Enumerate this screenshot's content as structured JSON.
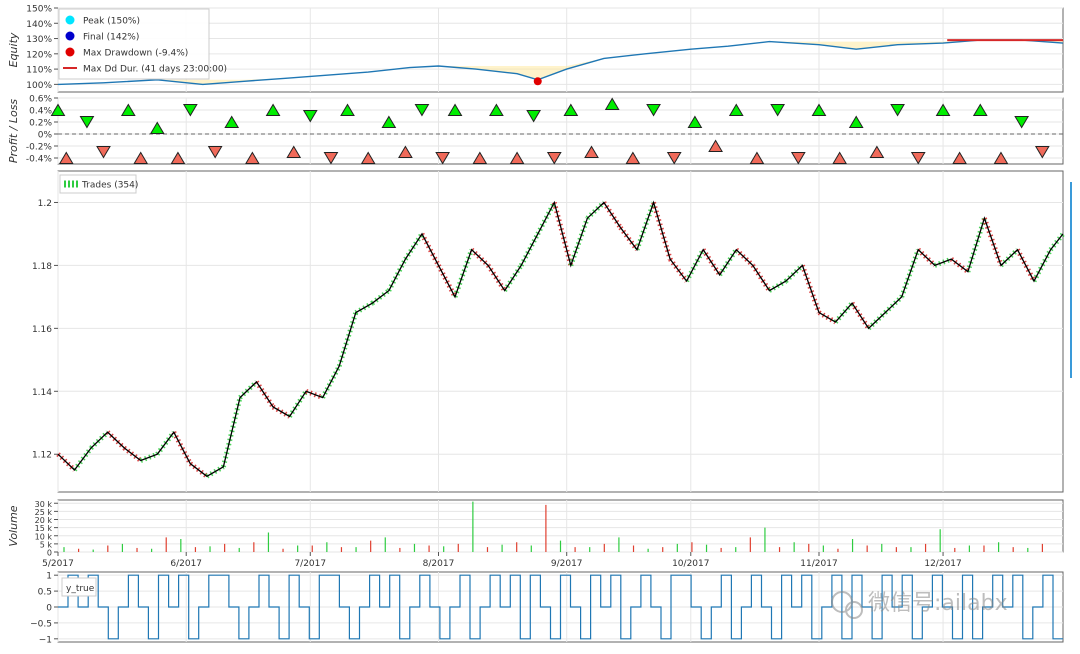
{
  "chart_data": [
    {
      "type": "line",
      "ylabel": "Equity",
      "ylim": [
        95,
        150
      ],
      "yticks": [
        "150%",
        "140%",
        "130%",
        "120%",
        "110%",
        "100%"
      ],
      "ytick_values": [
        150,
        140,
        130,
        120,
        110,
        100
      ],
      "legend": [
        "Peak (150%)",
        "Final (142%)",
        "Max Drawdown (-9.4%)",
        "Max Dd Dur. (41 days 23:00:00)"
      ],
      "legend_colors": [
        "#00e5ff",
        "#0000cc",
        "#e00000",
        "#d62728"
      ],
      "series": [
        {
          "name": "Equity",
          "color": "#1f77b4",
          "x": [
            "2017-05-01",
            "2017-05-12",
            "2017-05-25",
            "2017-06-05",
            "2017-06-15",
            "2017-06-25",
            "2017-07-05",
            "2017-07-15",
            "2017-07-25",
            "2017-08-01",
            "2017-08-10",
            "2017-08-20",
            "2017-08-25",
            "2017-09-01",
            "2017-09-10",
            "2017-09-20",
            "2017-10-01",
            "2017-10-10",
            "2017-10-20",
            "2017-11-01",
            "2017-11-10",
            "2017-11-20",
            "2017-12-01",
            "2017-12-10",
            "2017-12-20",
            "2017-12-30"
          ],
          "values": [
            100,
            101,
            103,
            100,
            102,
            104,
            106,
            108,
            111,
            112,
            110,
            107,
            103,
            110,
            117,
            120,
            123,
            125,
            128,
            126,
            123,
            126,
            127,
            129,
            129,
            127
          ]
        }
      ],
      "peak": {
        "x": "2017-12-05",
        "value": 150
      },
      "max_drawdown": {
        "x": "2017-08-25",
        "value": 102
      },
      "drawdown_duration": {
        "x_start": "2017-12-02",
        "x_end": "2017-12-30",
        "value": 129
      }
    },
    {
      "type": "scatter",
      "ylabel": "Profit / Loss",
      "ylim": [
        -0.5,
        0.6
      ],
      "yticks": [
        "0.6%",
        "0.4%",
        "0.2%",
        "0%",
        "-0.2%",
        "-0.4%"
      ],
      "ytick_values": [
        0.6,
        0.4,
        0.2,
        0,
        -0.2,
        -0.4
      ],
      "series": [
        {
          "name": "Profit",
          "color": "#00ee00",
          "x": [
            "2017-05-01",
            "2017-05-08",
            "2017-05-18",
            "2017-05-25",
            "2017-06-02",
            "2017-06-12",
            "2017-06-22",
            "2017-07-01",
            "2017-07-10",
            "2017-07-20",
            "2017-07-28",
            "2017-08-05",
            "2017-08-15",
            "2017-08-24",
            "2017-09-02",
            "2017-09-12",
            "2017-09-22",
            "2017-10-02",
            "2017-10-12",
            "2017-10-22",
            "2017-11-01",
            "2017-11-10",
            "2017-11-20",
            "2017-12-01",
            "2017-12-10",
            "2017-12-20"
          ],
          "values": [
            0.4,
            0.2,
            0.4,
            0.1,
            0.4,
            0.2,
            0.4,
            0.3,
            0.4,
            0.2,
            0.4,
            0.4,
            0.4,
            0.3,
            0.4,
            0.5,
            0.4,
            0.2,
            0.4,
            0.4,
            0.4,
            0.2,
            0.4,
            0.4,
            0.4,
            0.2
          ]
        },
        {
          "name": "Loss",
          "color": "#f06a5a",
          "x": [
            "2017-05-03",
            "2017-05-12",
            "2017-05-21",
            "2017-05-30",
            "2017-06-08",
            "2017-06-17",
            "2017-06-27",
            "2017-07-06",
            "2017-07-15",
            "2017-07-24",
            "2017-08-02",
            "2017-08-11",
            "2017-08-20",
            "2017-08-29",
            "2017-09-07",
            "2017-09-17",
            "2017-09-27",
            "2017-10-07",
            "2017-10-17",
            "2017-10-27",
            "2017-11-06",
            "2017-11-15",
            "2017-11-25",
            "2017-12-05",
            "2017-12-15",
            "2017-12-25"
          ],
          "values": [
            -0.4,
            -0.3,
            -0.4,
            -0.4,
            -0.3,
            -0.4,
            -0.3,
            -0.4,
            -0.4,
            -0.3,
            -0.4,
            -0.4,
            -0.4,
            -0.4,
            -0.3,
            -0.4,
            -0.4,
            -0.2,
            -0.4,
            -0.4,
            -0.4,
            -0.3,
            -0.4,
            -0.4,
            -0.4,
            -0.3
          ]
        }
      ]
    },
    {
      "type": "line",
      "ylim": [
        1.108,
        1.21
      ],
      "yticks": [
        "1.2",
        "1.18",
        "1.16",
        "1.14",
        "1.12"
      ],
      "ytick_values": [
        1.2,
        1.18,
        1.16,
        1.14,
        1.12
      ],
      "legend": [
        "Trades (354)"
      ],
      "series": [
        {
          "name": "Price",
          "color": "#000000",
          "x": [
            "2017-05-01",
            "2017-05-05",
            "2017-05-09",
            "2017-05-13",
            "2017-05-17",
            "2017-05-21",
            "2017-05-25",
            "2017-05-29",
            "2017-06-02",
            "2017-06-06",
            "2017-06-10",
            "2017-06-14",
            "2017-06-18",
            "2017-06-22",
            "2017-06-26",
            "2017-06-30",
            "2017-07-04",
            "2017-07-08",
            "2017-07-12",
            "2017-07-16",
            "2017-07-20",
            "2017-07-24",
            "2017-07-28",
            "2017-08-01",
            "2017-08-05",
            "2017-08-09",
            "2017-08-13",
            "2017-08-17",
            "2017-08-21",
            "2017-08-25",
            "2017-08-29",
            "2017-09-02",
            "2017-09-06",
            "2017-09-10",
            "2017-09-14",
            "2017-09-18",
            "2017-09-22",
            "2017-09-26",
            "2017-09-30",
            "2017-10-04",
            "2017-10-08",
            "2017-10-12",
            "2017-10-16",
            "2017-10-20",
            "2017-10-24",
            "2017-10-28",
            "2017-11-01",
            "2017-11-05",
            "2017-11-09",
            "2017-11-13",
            "2017-11-17",
            "2017-11-21",
            "2017-11-25",
            "2017-11-29",
            "2017-12-03",
            "2017-12-07",
            "2017-12-11",
            "2017-12-15",
            "2017-12-19",
            "2017-12-23",
            "2017-12-27",
            "2017-12-30"
          ],
          "values": [
            1.12,
            1.115,
            1.122,
            1.127,
            1.122,
            1.118,
            1.12,
            1.127,
            1.117,
            1.113,
            1.116,
            1.138,
            1.143,
            1.135,
            1.132,
            1.14,
            1.138,
            1.148,
            1.165,
            1.168,
            1.172,
            1.182,
            1.19,
            1.18,
            1.17,
            1.185,
            1.18,
            1.172,
            1.18,
            1.19,
            1.2,
            1.18,
            1.195,
            1.2,
            1.192,
            1.185,
            1.2,
            1.182,
            1.175,
            1.185,
            1.177,
            1.185,
            1.18,
            1.172,
            1.175,
            1.18,
            1.165,
            1.162,
            1.168,
            1.16,
            1.165,
            1.17,
            1.185,
            1.18,
            1.182,
            1.178,
            1.195,
            1.18,
            1.185,
            1.175,
            1.185,
            1.19
          ]
        }
      ]
    },
    {
      "type": "bar",
      "ylabel": "Volume",
      "ylim": [
        0,
        32000
      ],
      "yticks": [
        "30 k",
        "25 k",
        "20 k",
        "15 k",
        "10 k",
        "5 k",
        "0"
      ],
      "ytick_values": [
        30000,
        25000,
        20000,
        15000,
        10000,
        5000,
        0
      ],
      "xticks": [
        "5/2017",
        "6/2017",
        "7/2017",
        "8/2017",
        "9/2017",
        "10/2017",
        "11/2017",
        "12/2017"
      ],
      "xtick_dates": [
        "2017-05-01",
        "2017-06-01",
        "2017-07-01",
        "2017-08-01",
        "2017-09-01",
        "2017-10-01",
        "2017-11-01",
        "2017-12-01"
      ],
      "series": [
        {
          "name": "Up",
          "color": "#2ecc40",
          "values": [
            3000,
            1500,
            5000,
            2000,
            8000,
            3500,
            2500,
            12000,
            4000,
            6000,
            3000,
            9000,
            5000,
            3500,
            31000,
            4500,
            4000,
            7000,
            3000,
            9000,
            2000,
            5000,
            4500,
            3000,
            15000,
            6000,
            4000,
            8000,
            5000,
            3000,
            14000,
            4000,
            6000,
            2500
          ]
        },
        {
          "name": "Down",
          "color": "#e04030",
          "values": [
            2000,
            4000,
            2500,
            9000,
            3000,
            5000,
            6000,
            2000,
            4000,
            3000,
            7000,
            2500,
            4000,
            5000,
            3000,
            6000,
            29000,
            3000,
            5000,
            4000,
            3000,
            6000,
            2500,
            9000,
            3000,
            5000,
            2000,
            4000,
            3000,
            5000,
            2500,
            4000,
            3000,
            5000
          ]
        }
      ]
    },
    {
      "type": "line",
      "legend": [
        "y_true"
      ],
      "ylim": [
        -1.1,
        1.1
      ],
      "yticks": [
        "1",
        "0.5",
        "0",
        "−0.5",
        "−1"
      ],
      "ytick_values": [
        1,
        0.5,
        0,
        -0.5,
        -1
      ],
      "series": [
        {
          "name": "y_true",
          "color": "#1f77b4",
          "values": [
            0,
            1,
            0,
            1,
            0,
            -1,
            0,
            1,
            0,
            -1,
            1,
            0,
            1,
            -1,
            0,
            1,
            1,
            0,
            -1,
            0,
            1,
            0,
            -1,
            1,
            0,
            -1,
            1,
            1,
            0,
            -1,
            0,
            1,
            0,
            1,
            -1,
            0,
            1,
            0,
            -1,
            0,
            1,
            -1,
            0,
            1,
            0,
            1,
            -1,
            1,
            0,
            -1,
            1,
            0,
            -1,
            1,
            0,
            1,
            -1,
            0,
            1,
            0,
            -1,
            1,
            1,
            0,
            -1,
            0,
            1,
            -1,
            0,
            1,
            0,
            -1,
            1,
            0,
            1,
            -1,
            0,
            1,
            -1,
            1,
            0,
            -1,
            1,
            0,
            1,
            -1,
            0,
            1,
            0,
            -1,
            1,
            -1,
            0,
            1,
            0,
            1,
            -1,
            0,
            1,
            -1
          ]
        }
      ]
    }
  ],
  "watermark": "微信号:ailabx"
}
